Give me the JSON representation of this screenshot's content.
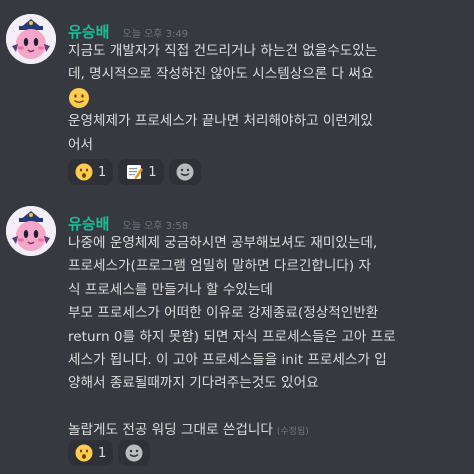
{
  "messages": [
    {
      "username": "유승배",
      "timestamp": "오늘 오후 3:49",
      "lines": [
        "지금도 개발자가 직접 건드리거나 하는건 없을수도있는",
        "데, 명시적으로 작성하진 않아도 시스템상으론 다 써요",
        "",
        "운영체제가 프로세스가 끝나면 처리해야하고 이런게있",
        "어서"
      ],
      "inline_emoji": "slightly-smiling-face",
      "reactions": [
        {
          "icon": "hushed-face",
          "count": "1"
        },
        {
          "icon": "memo",
          "count": "1"
        }
      ]
    },
    {
      "username": "유승배",
      "timestamp": "오늘 오후 3:58",
      "lines": [
        "나중에 운영체제 궁금하시면 공부해보셔도 재미있는데,",
        "프로세스가(프로그램 엄밀히 말하면 다르긴합니다) 자",
        "식 프로세스를 만들거나 할  수있는데",
        "부모 프로세스가 어떠한 이유로 강제종료(정상적인반환",
        "return 0를 하지 못함) 되면 자식 프로세스들은 고아 프로",
        "세스가 됩니다. 이 고아 프로세스들을 init 프로세스가 입",
        "양해서 종료될때까지 기다려주는것도 있어요",
        "",
        "놀랍게도 전공 워딩 그대로 쓴겁니다"
      ],
      "edited": "(수정됨)",
      "reactions": [
        {
          "icon": "hushed-face",
          "count": "1"
        }
      ]
    }
  ],
  "colors": {
    "background": "#36393f",
    "username": "#1abc9c",
    "timestamp": "#72767d",
    "text": "#dcddde",
    "reaction_bg": "#2f3136"
  }
}
